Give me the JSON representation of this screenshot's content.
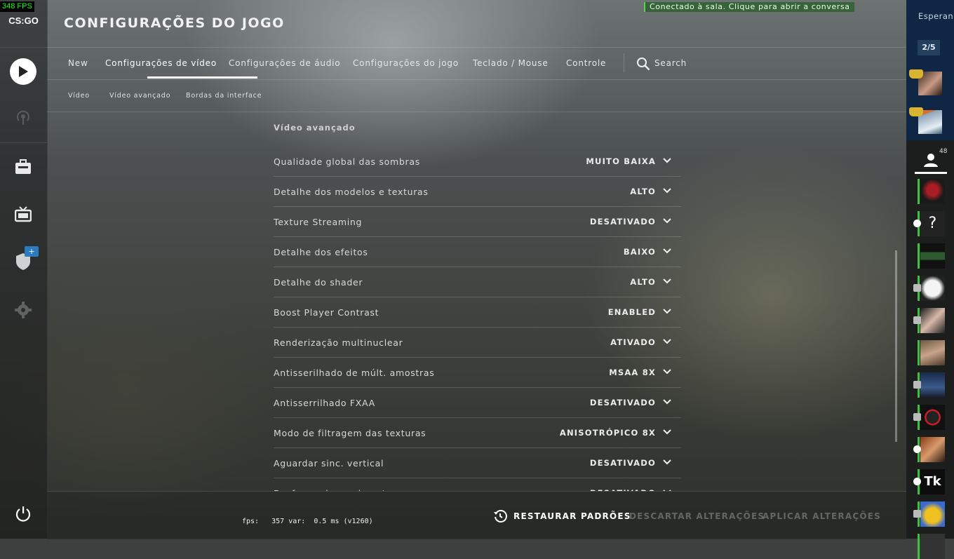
{
  "fps_counter": "348 FPS",
  "app": {
    "logo": "CS:GO",
    "title": "CONFIGURAÇÕES DO JOGO"
  },
  "notification": "Conectado à sala. Clique para abrir a conversa",
  "left_nav": {
    "icons": [
      "play-icon",
      "broadcast-icon",
      "inventory-icon",
      "watch-tv-icon",
      "shield-icon",
      "gear-icon",
      "power-icon"
    ],
    "badge": "+"
  },
  "tabs": [
    "New",
    "Configurações de vídeo",
    "Configurações de áudio",
    "Configurações do jogo",
    "Teclado / Mouse",
    "Controle"
  ],
  "search_label": "Search",
  "subtabs": [
    "Vídeo",
    "Vídeo avançado",
    "Bordas da interface"
  ],
  "section_title": "Vídeo avançado",
  "settings": [
    {
      "label": "Qualidade global das sombras",
      "value": "MUITO BAIXA"
    },
    {
      "label": "Detalhe dos modelos e texturas",
      "value": "ALTO"
    },
    {
      "label": "Texture Streaming",
      "value": "DESATIVADO"
    },
    {
      "label": "Detalhe dos efeitos",
      "value": "BAIXO"
    },
    {
      "label": "Detalhe do shader",
      "value": "ALTO"
    },
    {
      "label": "Boost Player Contrast",
      "value": "ENABLED"
    },
    {
      "label": "Renderização multinuclear",
      "value": "ATIVADO"
    },
    {
      "label": "Antisserilhado de múlt. amostras",
      "value": "MSAA 8X"
    },
    {
      "label": "Antisserrilhado FXAA",
      "value": "DESATIVADO"
    },
    {
      "label": "Modo de filtragem das texturas",
      "value": "ANISOTRÓPICO 8X"
    },
    {
      "label": "Aguardar sinc. vertical",
      "value": "DESATIVADO"
    },
    {
      "label": "Desfoque de movimento",
      "value": "DESATIVADO"
    }
  ],
  "bottom": {
    "fps_line": "fps:   357 var:  0.5 ms (v1260)",
    "restore": "RESTAURAR PADRÕES",
    "discard": "DESCARTAR ALTERAÇÕES",
    "apply": "APLICAR ALTERAÇÕES"
  },
  "lobby": {
    "label": "Esperando",
    "count": "2/5"
  },
  "friends": {
    "count": "48"
  },
  "colors": {
    "online_green": "#3fc33f",
    "lobby_blue": "#0f2745",
    "badge_blue": "#2d7bbf"
  }
}
